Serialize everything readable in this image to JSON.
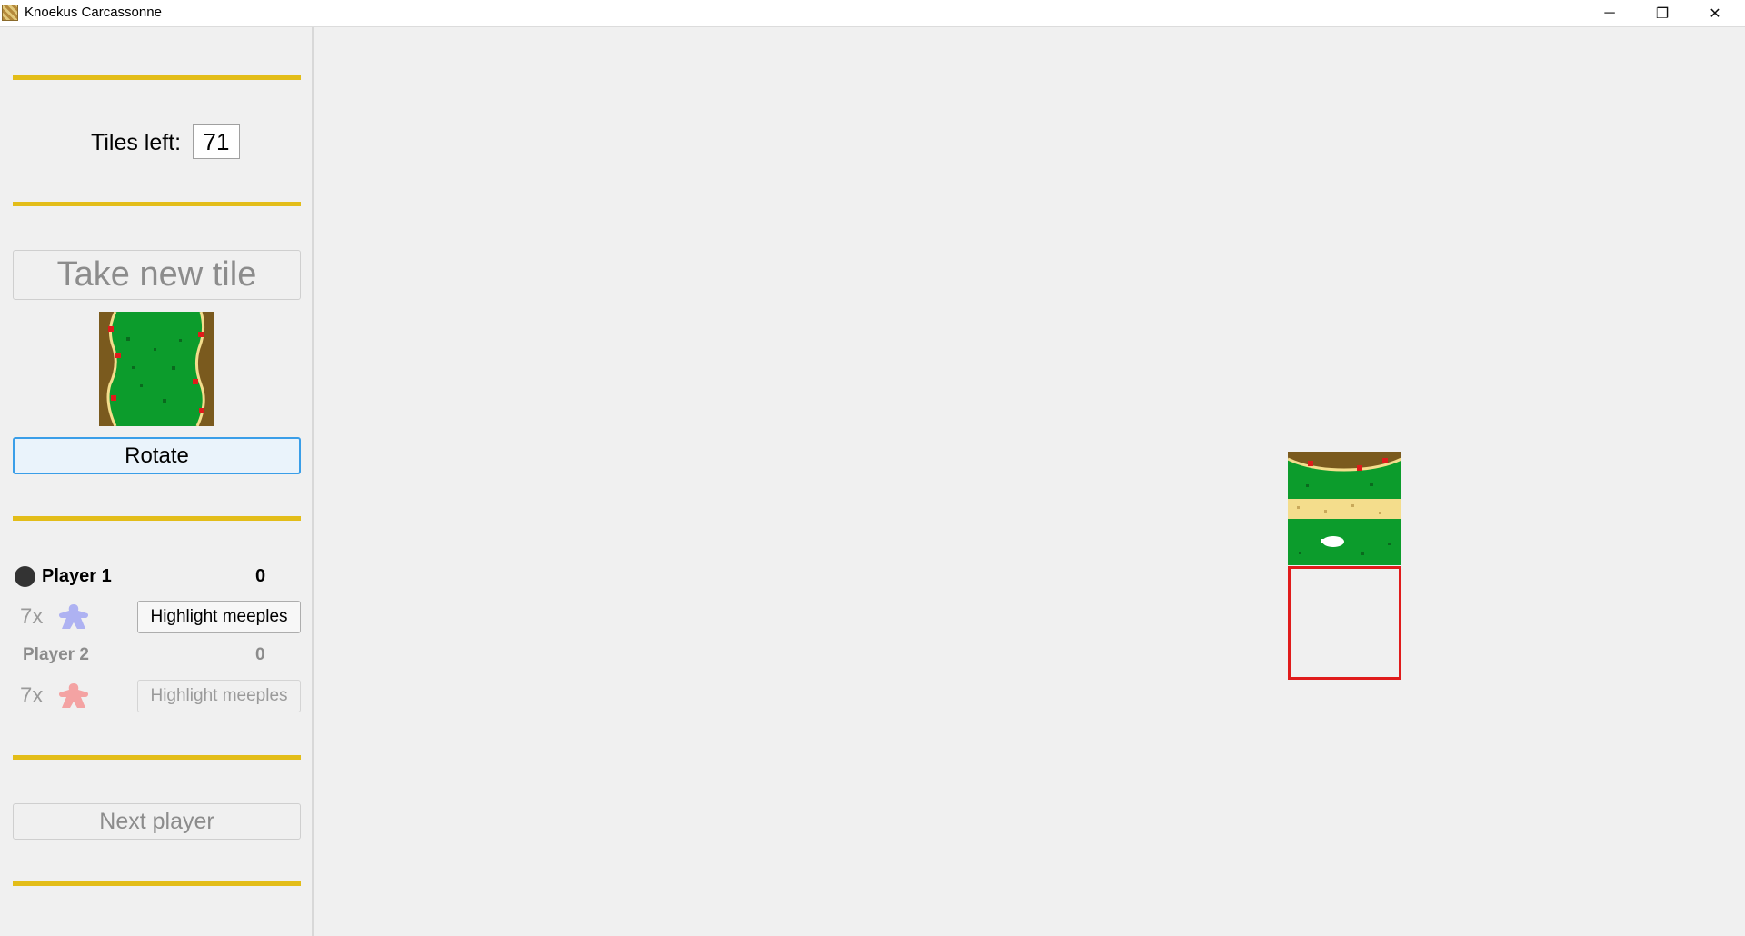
{
  "window": {
    "title": "Knoekus Carcassonne",
    "minimize_glyph": "─",
    "maximize_glyph": "❐",
    "close_glyph": "✕"
  },
  "sidebar": {
    "tiles_left_label": "Tiles left:",
    "tiles_left_value": "71",
    "take_new_tile_label": "Take new tile",
    "rotate_label": "Rotate",
    "next_player_label": "Next player",
    "players": [
      {
        "name": "Player 1",
        "score": "0",
        "meeples": "7x",
        "highlight_label": "Highlight meeples",
        "meeple_color": "#aeb2f2",
        "active": true
      },
      {
        "name": "Player 2",
        "score": "0",
        "meeples": "7x",
        "highlight_label": "Highlight meeples",
        "meeple_color": "#f4a3a3",
        "active": false
      }
    ]
  },
  "colors": {
    "divider": "#e3bd19",
    "grass": "#0c9c2c",
    "city": "#7a5a1e",
    "road": "#f4dd8c",
    "highlight_border": "#e01b1b",
    "focus_blue": "#3a9ee8"
  },
  "icons": {
    "app": "carcassonne-app-icon",
    "current_tile": "city-sides-tile",
    "placed_tile": "city-road-tile",
    "meeple": "meeple-icon"
  }
}
